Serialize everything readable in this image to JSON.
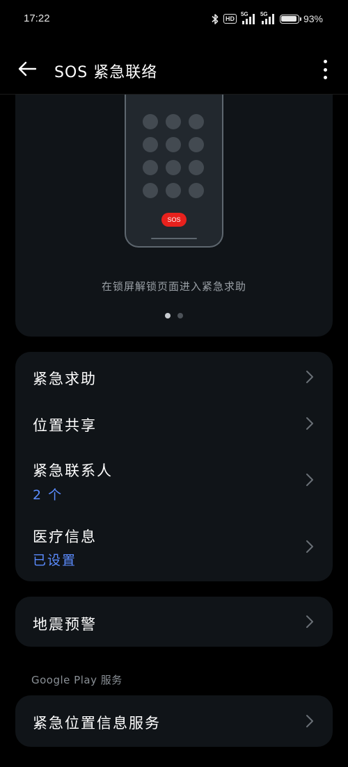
{
  "status_bar": {
    "time": "17:22",
    "hd": "HD",
    "sim1": "5G",
    "sim2": "5G",
    "battery_percent": "93%",
    "battery_level": 0.93
  },
  "app_bar": {
    "title": "SOS 紧急联络",
    "back_icon": "arrow-left-icon",
    "more_icon": "more-vertical-icon"
  },
  "illustration": {
    "sos_label": "SOS",
    "caption": "在锁屏解锁页面进入紧急求助",
    "page_count": 2,
    "active_page": 0
  },
  "settings_group_1": [
    {
      "title": "紧急求助",
      "subtitle": ""
    },
    {
      "title": "位置共享",
      "subtitle": ""
    },
    {
      "title": "紧急联系人",
      "subtitle": "2 个"
    },
    {
      "title": "医疗信息",
      "subtitle": "已设置"
    }
  ],
  "settings_group_2": [
    {
      "title": "地震预警"
    }
  ],
  "section_google": {
    "label": "Google Play 服务",
    "items": [
      {
        "title": "紧急位置信息服务"
      }
    ]
  },
  "colors": {
    "background": "#000000",
    "card": "#101418",
    "accent": "#5b8cff",
    "sos": "#e8211d"
  }
}
